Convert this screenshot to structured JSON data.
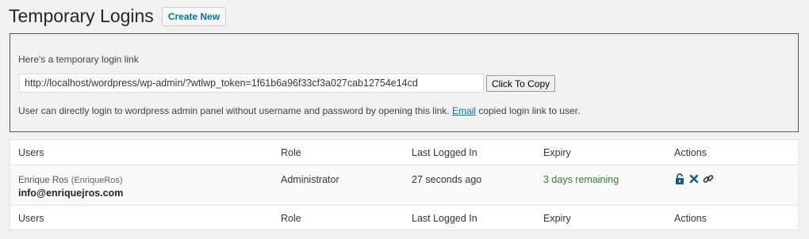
{
  "header": {
    "title": "Temporary Logins",
    "create_label": "Create New"
  },
  "notice": {
    "heading": "Here's a temporary login link",
    "link_value": "http://localhost/wordpress/wp-admin/?wtlwp_token=1f61b6a96f33cf3a027cab12754e14cd",
    "copy_label": "Click To Copy",
    "desc_before": "User can directly login to wordpress admin panel without username and password by opening this link.",
    "email_link": "Email",
    "desc_after": "copied login link to user."
  },
  "table": {
    "columns": [
      "Users",
      "Role",
      "Last Logged In",
      "Expiry",
      "Actions"
    ],
    "rows": [
      {
        "name": "Enrique Ros",
        "login": "(EnriqueRos)",
        "email": "info@enriquejros.com",
        "role": "Administrator",
        "last_logged_in": "27 seconds ago",
        "expiry": "3 days remaining",
        "actions": [
          "lock-open-icon",
          "close-icon",
          "link-icon"
        ]
      }
    ]
  },
  "colors": {
    "accent": "#0073aa",
    "expiry": "#2a8a2a",
    "icon": "#1a5a8a"
  }
}
